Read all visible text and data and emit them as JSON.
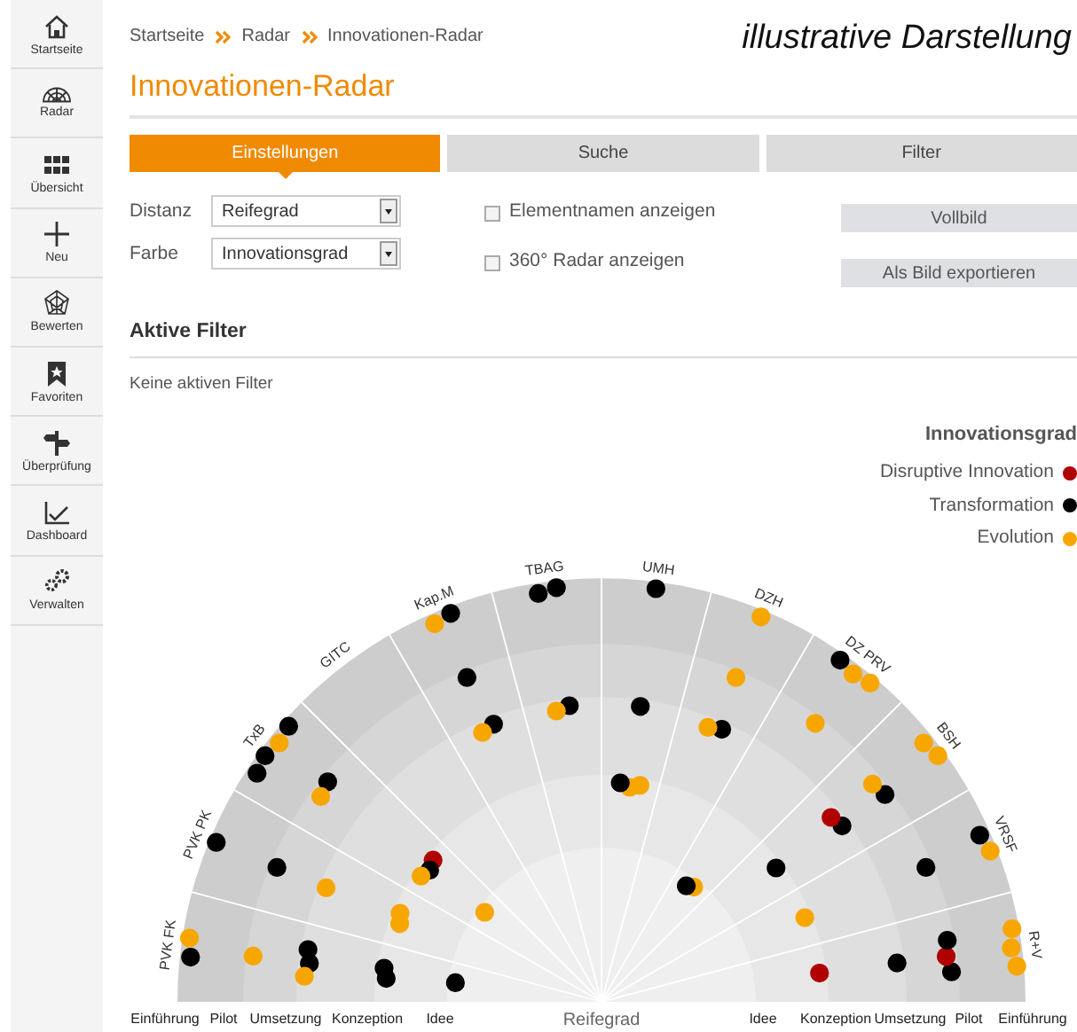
{
  "sidebar": {
    "items": [
      "Startseite",
      "Radar",
      "Übersicht",
      "Neu",
      "Bewerten",
      "Favoriten",
      "Überprüfung",
      "Dashboard",
      "Verwalten"
    ]
  },
  "breadcrumb": [
    "Startseite",
    "Radar",
    "Innovationen-Radar"
  ],
  "note": "illustrative Darstellung",
  "title": "Innovationen-Radar",
  "tabs": [
    {
      "label": "Einstellungen",
      "selected": true
    },
    {
      "label": "Suche",
      "selected": false
    },
    {
      "label": "Filter",
      "selected": false
    }
  ],
  "settings": {
    "fields": [
      {
        "label": "Distanz",
        "value": "Reifegrad"
      },
      {
        "label": "Farbe",
        "value": "Innovationsgrad"
      }
    ],
    "options": [
      {
        "label": "Elementnamen anzeigen",
        "checked": false
      },
      {
        "label": "360° Radar anzeigen",
        "checked": false
      }
    ],
    "buttons": [
      "Vollbild",
      "Als Bild exportieren"
    ]
  },
  "filters": {
    "heading": "Aktive Filter",
    "text": "Keine aktiven Filter"
  },
  "legend": {
    "title": "Innovationsgrad",
    "items": [
      {
        "label": "Disruptive Innovation",
        "color": "#b00000"
      },
      {
        "label": "Transformation",
        "color": "#000000"
      },
      {
        "label": "Evolution",
        "color": "#f7a600"
      }
    ]
  },
  "radar": {
    "axis_label": "Reifegrad",
    "rings": [
      {
        "kind": "einfuehrung",
        "label": "Einführung"
      },
      {
        "kind": "pilot",
        "label": "Pilot"
      },
      {
        "kind": "umsetzung",
        "label": "Umsetzung"
      },
      {
        "kind": "konzeption",
        "label": "Konzeption"
      },
      {
        "kind": "idee",
        "label": "Idee"
      }
    ],
    "right_labels": [
      "Idee",
      "Konzeption",
      "Umsetzung",
      "Pilot",
      "Einführung"
    ],
    "sectors": [
      {
        "label": "PVK FK",
        "blips": [
          {
            "kind": "einfuehrung",
            "color": "#f7a600"
          },
          {
            "kind": "einfuehrung",
            "color": "#000000"
          },
          {
            "kind": "pilot",
            "color": "#f7a600"
          },
          {
            "kind": "umsetzung",
            "color": "#000000"
          },
          {
            "kind": "umsetzung",
            "color": "#000000"
          },
          {
            "kind": "umsetzung",
            "color": "#f7a600"
          },
          {
            "kind": "konzeption",
            "color": "#000000"
          },
          {
            "kind": "konzeption",
            "color": "#000000"
          },
          {
            "kind": "idee",
            "color": "#000000"
          }
        ]
      },
      {
        "label": "PVK PK",
        "blips": [
          {
            "kind": "einfuehrung",
            "color": "#000000"
          },
          {
            "kind": "pilot",
            "color": "#000000"
          },
          {
            "kind": "umsetzung",
            "color": "#f7a600"
          },
          {
            "kind": "konzeption",
            "color": "#f7a600"
          },
          {
            "kind": "konzeption",
            "color": "#f7a600"
          }
        ]
      },
      {
        "label": "TxB",
        "blips": [
          {
            "kind": "einfuehrung",
            "color": "#000000"
          },
          {
            "kind": "einfuehrung",
            "color": "#f7a600"
          },
          {
            "kind": "einfuehrung",
            "color": "#000000"
          },
          {
            "kind": "einfuehrung",
            "color": "#000000"
          },
          {
            "kind": "pilot",
            "color": "#000000"
          },
          {
            "kind": "pilot",
            "color": "#f7a600"
          },
          {
            "kind": "konzeption",
            "color": "#b00000"
          },
          {
            "kind": "konzeption",
            "color": "#000000"
          },
          {
            "kind": "konzeption",
            "color": "#f7a600"
          },
          {
            "kind": "idee",
            "color": "#f7a600"
          }
        ]
      },
      {
        "label": "GITC"
      },
      {
        "label": "Kap.M",
        "blips": [
          {
            "kind": "einfuehrung",
            "color": "#000000"
          },
          {
            "kind": "einfuehrung",
            "color": "#f7a600"
          },
          {
            "kind": "pilot",
            "color": "#000000"
          },
          {
            "kind": "umsetzung",
            "color": "#000000"
          },
          {
            "kind": "umsetzung",
            "color": "#f7a600"
          }
        ]
      },
      {
        "label": "TBAG",
        "blips": [
          {
            "kind": "einfuehrung",
            "color": "#000000"
          },
          {
            "kind": "einfuehrung",
            "color": "#000000"
          },
          {
            "kind": "umsetzung",
            "color": "#000000"
          },
          {
            "kind": "umsetzung",
            "color": "#f7a600"
          }
        ]
      },
      {
        "label": "UMH",
        "blips": [
          {
            "kind": "einfuehrung",
            "color": "#000000"
          },
          {
            "kind": "umsetzung",
            "color": "#000000"
          },
          {
            "kind": "konzeption",
            "color": "#f7a600"
          },
          {
            "kind": "konzeption",
            "color": "#f7a600"
          },
          {
            "kind": "konzeption",
            "color": "#000000"
          }
        ]
      },
      {
        "label": "DZH",
        "blips": [
          {
            "kind": "einfuehrung",
            "color": "#f7a600"
          },
          {
            "kind": "pilot",
            "color": "#f7a600"
          },
          {
            "kind": "umsetzung",
            "color": "#000000"
          },
          {
            "kind": "umsetzung",
            "color": "#f7a600"
          }
        ]
      },
      {
        "label": "DZ PRV",
        "blips": [
          {
            "kind": "einfuehrung",
            "color": "#f7a600"
          },
          {
            "kind": "einfuehrung",
            "color": "#f7a600"
          },
          {
            "kind": "einfuehrung",
            "color": "#000000"
          },
          {
            "kind": "pilot",
            "color": "#f7a600"
          },
          {
            "kind": "idee",
            "color": "#f7a600"
          },
          {
            "kind": "idee",
            "color": "#000000"
          }
        ]
      },
      {
        "label": "BSH",
        "blips": [
          {
            "kind": "einfuehrung",
            "color": "#f7a600"
          },
          {
            "kind": "einfuehrung",
            "color": "#f7a600"
          },
          {
            "kind": "pilot",
            "color": "#000000"
          },
          {
            "kind": "pilot",
            "color": "#f7a600"
          },
          {
            "kind": "umsetzung",
            "color": "#000000"
          },
          {
            "kind": "umsetzung",
            "color": "#b00000"
          },
          {
            "kind": "konzeption",
            "color": "#000000"
          }
        ]
      },
      {
        "label": "VRSF",
        "blips": [
          {
            "kind": "einfuehrung",
            "color": "#f7a600"
          },
          {
            "kind": "einfuehrung",
            "color": "#000000"
          },
          {
            "kind": "pilot",
            "color": "#000000"
          },
          {
            "kind": "konzeption",
            "color": "#f7a600"
          }
        ]
      },
      {
        "label": "R+V",
        "blips": [
          {
            "kind": "einfuehrung",
            "color": "#f7a600"
          },
          {
            "kind": "einfuehrung",
            "color": "#f7a600"
          },
          {
            "kind": "einfuehrung",
            "color": "#f7a600"
          },
          {
            "kind": "pilot",
            "color": "#000000"
          },
          {
            "kind": "pilot",
            "color": "#b00000"
          },
          {
            "kind": "pilot",
            "color": "#000000"
          },
          {
            "kind": "umsetzung",
            "color": "#000000"
          },
          {
            "kind": "konzeption",
            "color": "#b00000"
          }
        ]
      }
    ]
  }
}
